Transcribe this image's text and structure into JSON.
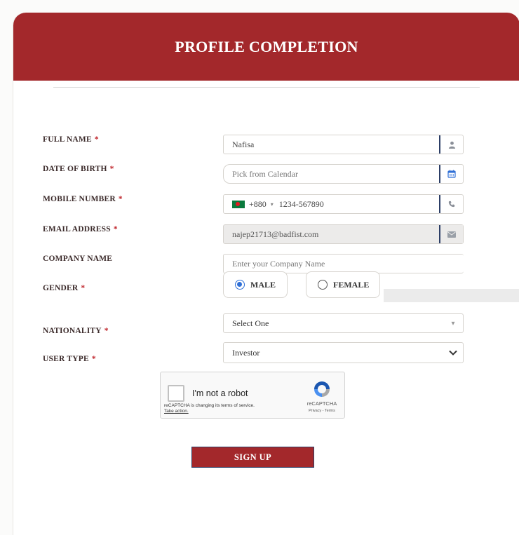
{
  "header": {
    "title": "PROFILE COMPLETION"
  },
  "colors": {
    "brand": "#a3282b",
    "accent": "#2f6fd6",
    "required": "#c0272d"
  },
  "form": {
    "required_mark": "*",
    "full_name": {
      "label": "FULL NAME",
      "value": "Nafisa",
      "icon": "user-icon"
    },
    "dob": {
      "label": "DATE OF BIRTH",
      "placeholder": "Pick from Calendar",
      "icon": "calendar-icon"
    },
    "mobile": {
      "label": "MOBILE NUMBER",
      "country_code": "+880",
      "caret": "▾",
      "value": "1234-567890",
      "icon": "phone-icon",
      "flag": "bangladesh-flag-icon"
    },
    "email": {
      "label": "EMAIL ADDRESS",
      "value": "najep21713@badfist.com",
      "icon": "envelope-icon"
    },
    "company": {
      "label": "COMPANY NAME",
      "placeholder": "Enter your Company Name"
    },
    "gender": {
      "label": "GENDER",
      "options": [
        "MALE",
        "FEMALE"
      ],
      "selected": "MALE"
    },
    "nationality": {
      "label": "NATIONALITY",
      "value": "Select One"
    },
    "user_type": {
      "label": "USER TYPE",
      "value": "Investor"
    }
  },
  "captcha": {
    "label": "I'm not a robot",
    "notice": "reCAPTCHA is changing its terms of service.",
    "notice_link": "Take action.",
    "brand": "reCAPTCHA",
    "terms": "Privacy - Terms"
  },
  "signup": {
    "label": "SIGN UP"
  }
}
